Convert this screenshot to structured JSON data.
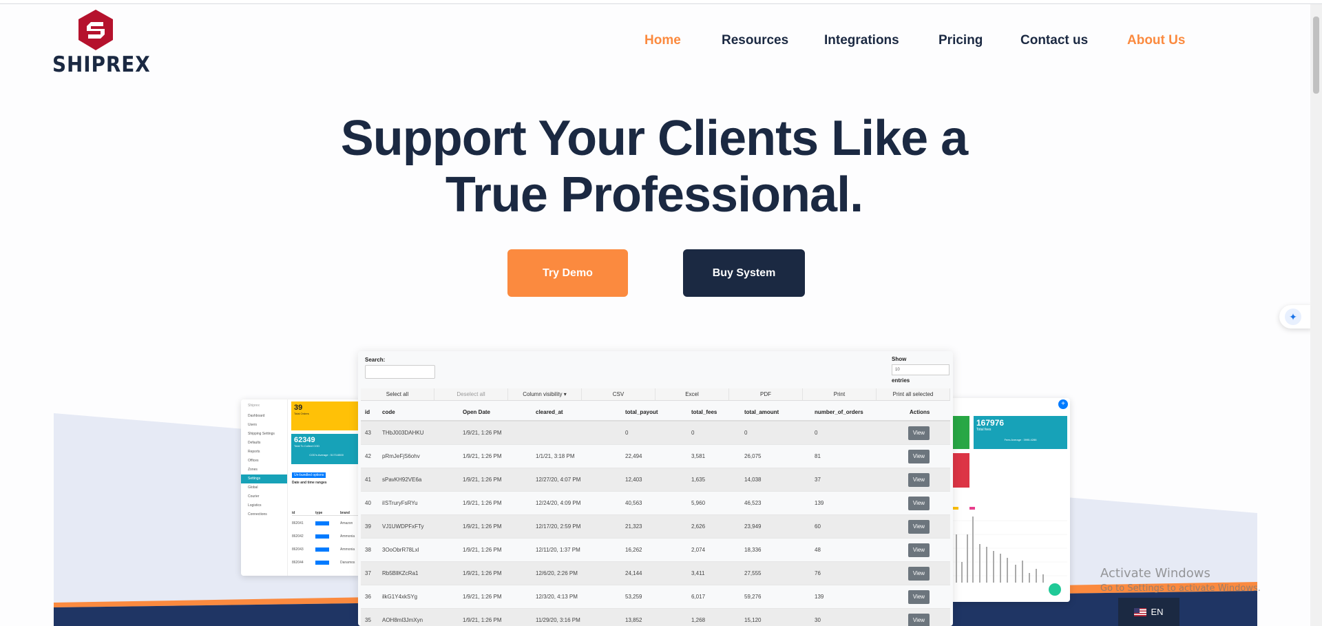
{
  "brand": {
    "name": "SHIPREX",
    "logo_color": "#b5122d",
    "text_color": "#1b2942"
  },
  "nav": {
    "items": [
      {
        "label": "Home",
        "active": true
      },
      {
        "label": "Resources",
        "active": false
      },
      {
        "label": "Integrations",
        "active": false
      },
      {
        "label": "Pricing",
        "active": false
      },
      {
        "label": "Contact us",
        "active": false
      },
      {
        "label": "About Us",
        "active": true
      }
    ]
  },
  "hero": {
    "title_line1": "Support Your Clients Like a",
    "title_line2": "True Professional.",
    "demo_button": "Try Demo",
    "buy_button": "Buy System"
  },
  "colors": {
    "accent": "#fb8a3f",
    "navy": "#1b2942"
  },
  "table_shot": {
    "search_label": "Search:",
    "show_label": "Show",
    "show_value": "10",
    "entries_label": "entries",
    "toolbar": [
      "Select all",
      "Deselect all",
      "Column visibility",
      "CSV",
      "Excel",
      "PDF",
      "Print",
      "Print all selected"
    ],
    "columns": [
      "id",
      "code",
      "Open Date",
      "cleared_at",
      "total_payout",
      "total_fees",
      "total_amount",
      "number_of_orders",
      "Actions"
    ],
    "view_label": "View",
    "rows": [
      [
        "43",
        "THbJ003DAHKU",
        "1/9/21, 1:26 PM",
        "",
        "0",
        "0",
        "0",
        "0"
      ],
      [
        "42",
        "pRmJeFjS6ohv",
        "1/9/21, 1:26 PM",
        "1/1/21, 3:18 PM",
        "22,494",
        "3,581",
        "26,075",
        "81"
      ],
      [
        "41",
        "sPavKH92VE6a",
        "1/9/21, 1:26 PM",
        "12/27/20, 4:07 PM",
        "12,403",
        "1,635",
        "14,038",
        "37"
      ],
      [
        "40",
        "iISTruryFsRYu",
        "1/9/21, 1:26 PM",
        "12/24/20, 4:09 PM",
        "40,563",
        "5,960",
        "46,523",
        "139"
      ],
      [
        "39",
        "VJ1UWDPFxFTy",
        "1/9/21, 1:26 PM",
        "12/17/20, 2:59 PM",
        "21,323",
        "2,626",
        "23,949",
        "60"
      ],
      [
        "38",
        "3OoObrR78Lxl",
        "1/9/21, 1:26 PM",
        "12/11/20, 1:37 PM",
        "16,262",
        "2,074",
        "18,336",
        "48"
      ],
      [
        "37",
        "Rb5BllKZcRa1",
        "1/9/21, 1:26 PM",
        "12/6/20, 2:26 PM",
        "24,144",
        "3,411",
        "27,555",
        "76"
      ],
      [
        "36",
        "ilkG1Y4xkSYg",
        "1/9/21, 1:26 PM",
        "12/3/20, 4:13 PM",
        "53,259",
        "6,017",
        "59,276",
        "139"
      ],
      [
        "35",
        "AOH8ml3JmXyn",
        "1/9/21, 1:26 PM",
        "11/29/20, 3:16 PM",
        "13,852",
        "1,268",
        "15,120",
        "30"
      ]
    ]
  },
  "mini_left": {
    "user": "Shiprex",
    "menu": [
      "Dashboard",
      "Users",
      "Shipping Settings",
      "Defaults",
      "Reports",
      "Offices",
      "Zones",
      "Settings",
      "Global",
      "Courier",
      "Logistics",
      "Connections"
    ],
    "card1_value": "39",
    "card1_label": "Total Orders",
    "card2_value": "62349",
    "card2_label": "Total To Collect COD",
    "card2_footer": "COD's Average : 5173.6500",
    "filter_button": "Un-bundled options",
    "filter_label": "Date and time ranges",
    "table_cols": [
      "id",
      "type",
      "brand"
    ],
    "rows": [
      [
        "862041",
        "Amazon"
      ],
      [
        "862042",
        "Ammonia"
      ],
      [
        "862043",
        "Ammonia"
      ],
      [
        "862044",
        "Danamos"
      ]
    ]
  },
  "mini_right": {
    "value": "167976",
    "label": "Total fees",
    "footer": "Fees Average : 3995.4286"
  },
  "system": {
    "activate_title": "Activate Windows",
    "activate_sub": "Go to Settings to activate Windows.",
    "lang": "EN"
  }
}
